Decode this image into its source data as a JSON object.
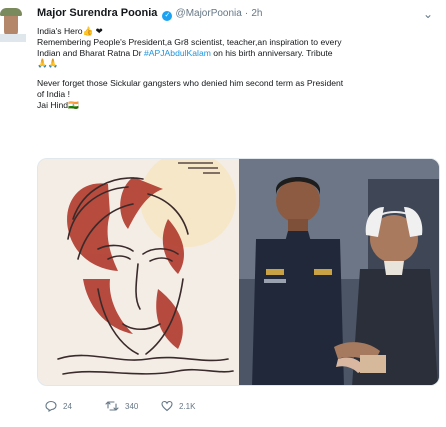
{
  "tweet": {
    "author_name": "Major Surendra Poonia",
    "handle": "@MajorPoonia",
    "separator": "·",
    "time": "2h",
    "lines": [
      "India's Hero👍 ❤",
      "Remembering People's President,a Gr8 scientist, teacher,an inspiration to every",
      "Indian and Bharat Ratna"
    ],
    "line3_tail": " Dr ",
    "hashtag": "#APJAbdulKalam",
    "line3_end": " on his birth anniversary. Tribute",
    "line4": "🙏🙏",
    "line5": "Never forget those Sickular gangsters who denied him second term as President",
    "line6": "of India !",
    "line7": "Jai Hind🇮🇳"
  },
  "actions": {
    "reply_count": "24",
    "retweet_count": "340",
    "like_count": "2.1K"
  },
  "icons": {
    "verified": "verified-badge-icon",
    "caret": "chevron-down-icon",
    "reply": "reply-icon",
    "retweet": "retweet-icon",
    "like": "heart-icon"
  },
  "colors": {
    "link": "#1b95e0",
    "verified": "#1da1f2",
    "muted": "#657786"
  }
}
